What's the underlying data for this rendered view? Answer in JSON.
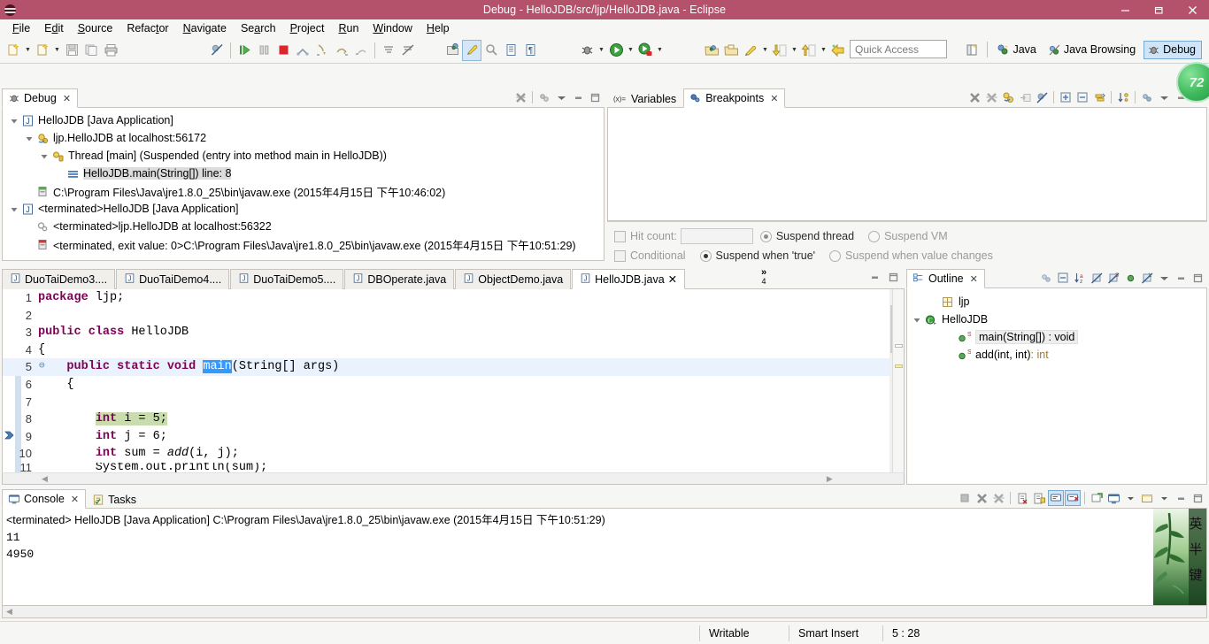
{
  "window": {
    "title": "Debug - HelloJDB/src/ljp/HelloJDB.java - Eclipse",
    "minimize_label": "Minimize",
    "restore_label": "Restore",
    "close_label": "Close"
  },
  "menubar": {
    "items": [
      {
        "label": "File"
      },
      {
        "label": "Edit"
      },
      {
        "label": "Source"
      },
      {
        "label": "Refactor"
      },
      {
        "label": "Navigate"
      },
      {
        "label": "Search"
      },
      {
        "label": "Project"
      },
      {
        "label": "Run"
      },
      {
        "label": "Window"
      },
      {
        "label": "Help"
      }
    ]
  },
  "toolbar": {
    "quick_access_placeholder": "Quick Access",
    "perspectives": [
      {
        "label": "Java",
        "active": false
      },
      {
        "label": "Java Browsing",
        "active": false
      },
      {
        "label": "Debug",
        "active": true
      }
    ],
    "badge_value": "72"
  },
  "debug_view": {
    "tab_label": "Debug",
    "tree": [
      {
        "indent": 0,
        "twisty": "collapse",
        "icon": "java-app-icon",
        "label": "HelloJDB [Java Application]",
        "selected": false
      },
      {
        "indent": 1,
        "twisty": "collapse",
        "icon": "debug-target-icon",
        "label": "ljp.HelloJDB at localhost:56172",
        "selected": false
      },
      {
        "indent": 2,
        "twisty": "collapse",
        "icon": "thread-suspended-icon",
        "label": "Thread [main] (Suspended (entry into method main in HelloJDB))",
        "selected": false
      },
      {
        "indent": 3,
        "twisty": "none",
        "icon": "stack-frame-icon",
        "label": "HelloJDB.main(String[]) line: 8",
        "selected": true
      },
      {
        "indent": 1,
        "twisty": "none",
        "icon": "process-icon",
        "label": "C:\\Program Files\\Java\\jre1.8.0_25\\bin\\javaw.exe (2015年4月15日 下午10:46:02)",
        "selected": false
      },
      {
        "indent": 0,
        "twisty": "collapse",
        "icon": "java-app-icon",
        "label": "<terminated>HelloJDB [Java Application]",
        "selected": false
      },
      {
        "indent": 1,
        "twisty": "none",
        "icon": "terminated-target-icon",
        "label": "<terminated>ljp.HelloJDB at localhost:56322",
        "selected": false
      },
      {
        "indent": 1,
        "twisty": "none",
        "icon": "terminated-process-icon",
        "label": "<terminated, exit value: 0>C:\\Program Files\\Java\\jre1.8.0_25\\bin\\javaw.exe (2015年4月15日 下午10:51:29)",
        "selected": false
      }
    ]
  },
  "breakpoints_view": {
    "tabs": [
      {
        "label": "Variables",
        "active": false,
        "icon": "variables-icon"
      },
      {
        "label": "Breakpoints",
        "active": true,
        "icon": "breakpoints-icon"
      }
    ],
    "options": {
      "hit_count_label": "Hit count:",
      "hit_count_value": "",
      "suspend_thread_label": "Suspend thread",
      "suspend_vm_label": "Suspend VM",
      "conditional_label": "Conditional",
      "suspend_true_label": "Suspend when 'true'",
      "suspend_change_label": "Suspend when value changes"
    }
  },
  "editor": {
    "tabs": [
      {
        "label": "DuoTaiDemo3....",
        "active": false
      },
      {
        "label": "DuoTaiDemo4....",
        "active": false
      },
      {
        "label": "DuoTaiDemo5....",
        "active": false
      },
      {
        "label": "DBOperate.java",
        "active": false
      },
      {
        "label": "ObjectDemo.java",
        "active": false
      },
      {
        "label": "HelloJDB.java",
        "active": true
      }
    ],
    "overflow_chevron": "»",
    "overflow_count": "4",
    "code_lines": [
      {
        "num": "1",
        "html": "<span class=\"kw\">package</span> ljp;",
        "style": "normal"
      },
      {
        "num": "2",
        "html": "",
        "style": "normal"
      },
      {
        "num": "3",
        "html": "<span class=\"kw\">public class</span> HelloJDB",
        "style": "normal"
      },
      {
        "num": "4",
        "html": "{",
        "style": "normal"
      },
      {
        "num": "5",
        "html": "    <span class=\"kw\">public static void</span> <span class=\"sel-word\">main</span>(String[] args)",
        "style": "current",
        "fold": true
      },
      {
        "num": "6",
        "html": "    {",
        "style": "normal"
      },
      {
        "num": "7",
        "html": "",
        "style": "normal"
      },
      {
        "num": "8",
        "html": "        <span class=\"hl-exec\"><span class=\"kw\">int</span> i = 5;</span>",
        "style": "exec"
      },
      {
        "num": "9",
        "html": "        <span class=\"kw\">int</span> j = 6;",
        "style": "normal"
      },
      {
        "num": "10",
        "html": "        <span class=\"kw\">int</span> sum = <span class=\"mth-static\">add</span>(i, j);",
        "style": "normal"
      },
      {
        "num": "11",
        "html": "        System.out.println(sum);",
        "style": "clipped"
      }
    ]
  },
  "outline_view": {
    "tab_label": "Outline",
    "items": [
      {
        "indent": 1,
        "twisty": "none",
        "icon": "package-icon",
        "label": "ljp",
        "selected": false,
        "suffix": ""
      },
      {
        "indent": 0,
        "twisty": "collapse",
        "icon": "class-icon",
        "label": "HelloJDB",
        "selected": false,
        "suffix": ""
      },
      {
        "indent": 2,
        "twisty": "none",
        "icon": "method-public-static-icon",
        "label": "main(String[]) : void",
        "selected": true,
        "suffix": ""
      },
      {
        "indent": 2,
        "twisty": "none",
        "icon": "method-public-static-icon",
        "label": "add(int, int)",
        "selected": false,
        "suffix": " : int"
      }
    ]
  },
  "console_view": {
    "tabs": [
      {
        "label": "Console",
        "active": true,
        "icon": "console-icon"
      },
      {
        "label": "Tasks",
        "active": false,
        "icon": "tasks-icon"
      }
    ],
    "header_line": "<terminated> HelloJDB [Java Application] C:\\Program Files\\Java\\jre1.8.0_25\\bin\\javaw.exe (2015年4月15日 下午10:51:29)",
    "output_lines": [
      "11",
      "4950"
    ],
    "ime_chars": [
      "英",
      "半",
      "键"
    ]
  },
  "statusbar": {
    "writable": "Writable",
    "insert_mode": "Smart Insert",
    "position": "5 : 28"
  }
}
